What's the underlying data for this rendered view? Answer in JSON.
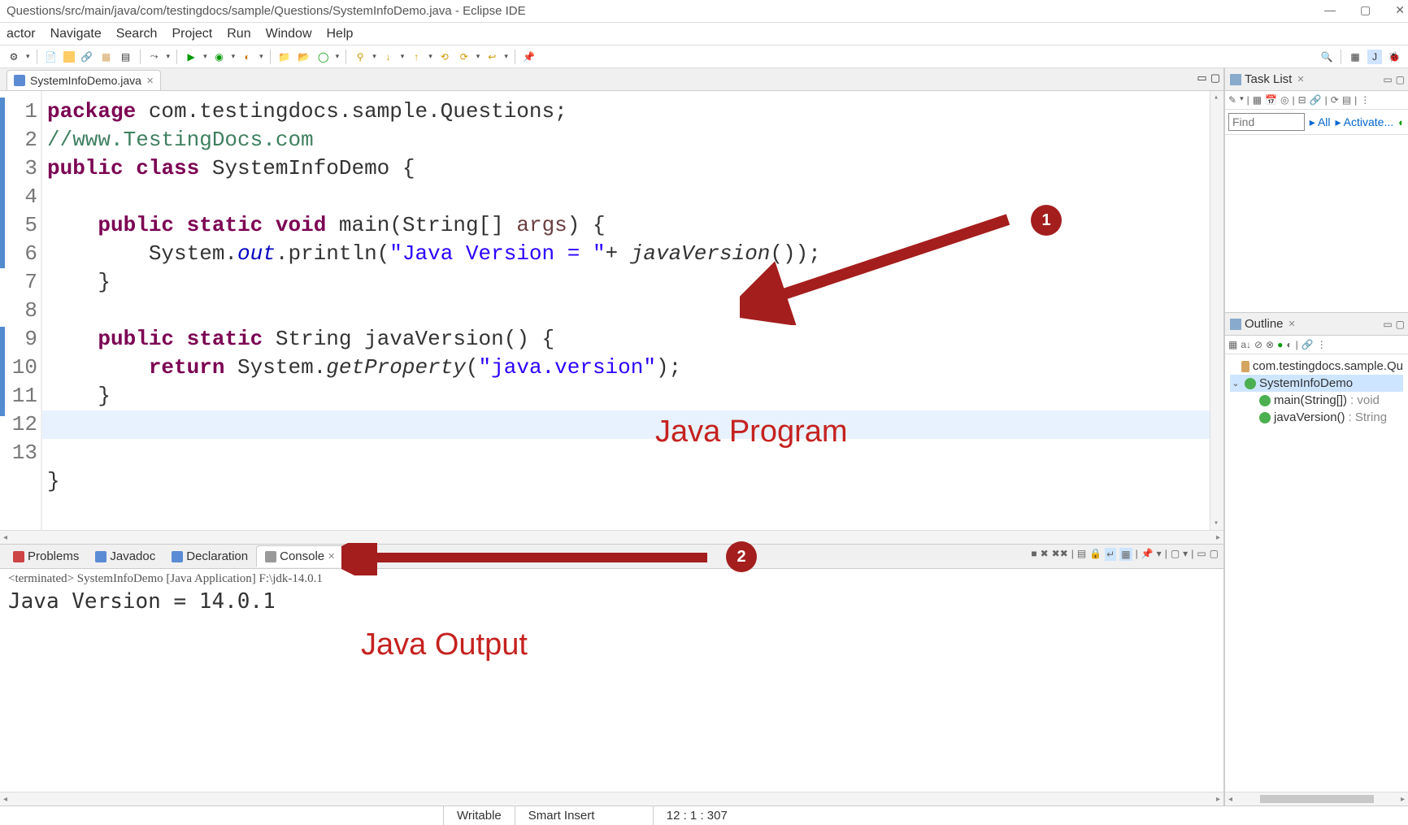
{
  "window": {
    "title": "Questions/src/main/java/com/testingdocs/sample/Questions/SystemInfoDemo.java - Eclipse IDE"
  },
  "menu": [
    "actor",
    "Navigate",
    "Search",
    "Project",
    "Run",
    "Window",
    "Help"
  ],
  "editor": {
    "tab_label": "SystemInfoDemo.java",
    "lines": [
      "1",
      "2",
      "3",
      "4",
      "5",
      "6",
      "7",
      "8",
      "9",
      "10",
      "11",
      "12",
      "13"
    ],
    "code": {
      "l1_package": "package",
      "l1_rest": " com.testingdocs.sample.Questions;",
      "l2": "//www.TestingDocs.com",
      "l3_public": "public",
      "l3_class": "class",
      "l3_name": " SystemInfoDemo {",
      "l5_public": "public",
      "l5_static": "static",
      "l5_void": "void",
      "l5_main": " main(String[] ",
      "l5_args": "args",
      "l5_end": ") {",
      "l6_pre": "        System.",
      "l6_out": "out",
      "l6_mid": ".println(",
      "l6_str": "\"Java Version = \"",
      "l6_plus": "+ ",
      "l6_call": "javaVersion",
      "l6_end": "());",
      "l7": "    }",
      "l9_public": "public",
      "l9_static": "static",
      "l9_rest": " String javaVersion() {",
      "l10_return": "return",
      "l10_mid": " System.",
      "l10_call": "getProperty",
      "l10_paren": "(",
      "l10_str": "\"java.version\"",
      "l10_end": ");",
      "l11": "    }",
      "l13": "}"
    }
  },
  "tasklist": {
    "title": "Task List",
    "find_placeholder": "Find",
    "all": "All",
    "activate": "Activate..."
  },
  "outline": {
    "title": "Outline",
    "package": "com.testingdocs.sample.Qu",
    "class": "SystemInfoDemo",
    "m1_name": "main(String[])",
    "m1_ret": " : void",
    "m2_name": "javaVersion()",
    "m2_ret": " : String"
  },
  "bottom": {
    "tabs": {
      "problems": "Problems",
      "javadoc": "Javadoc",
      "declaration": "Declaration",
      "console": "Console"
    },
    "console_header": "<terminated> SystemInfoDemo [Java Application] F:\\jdk-14.0.1",
    "console_output": "Java Version = 14.0.1"
  },
  "status": {
    "writable": "Writable",
    "insert": "Smart Insert",
    "pos": "12 : 1 : 307"
  },
  "annotations": {
    "java_program": "Java Program",
    "java_output": "Java Output",
    "circle1": "1",
    "circle2": "2"
  }
}
